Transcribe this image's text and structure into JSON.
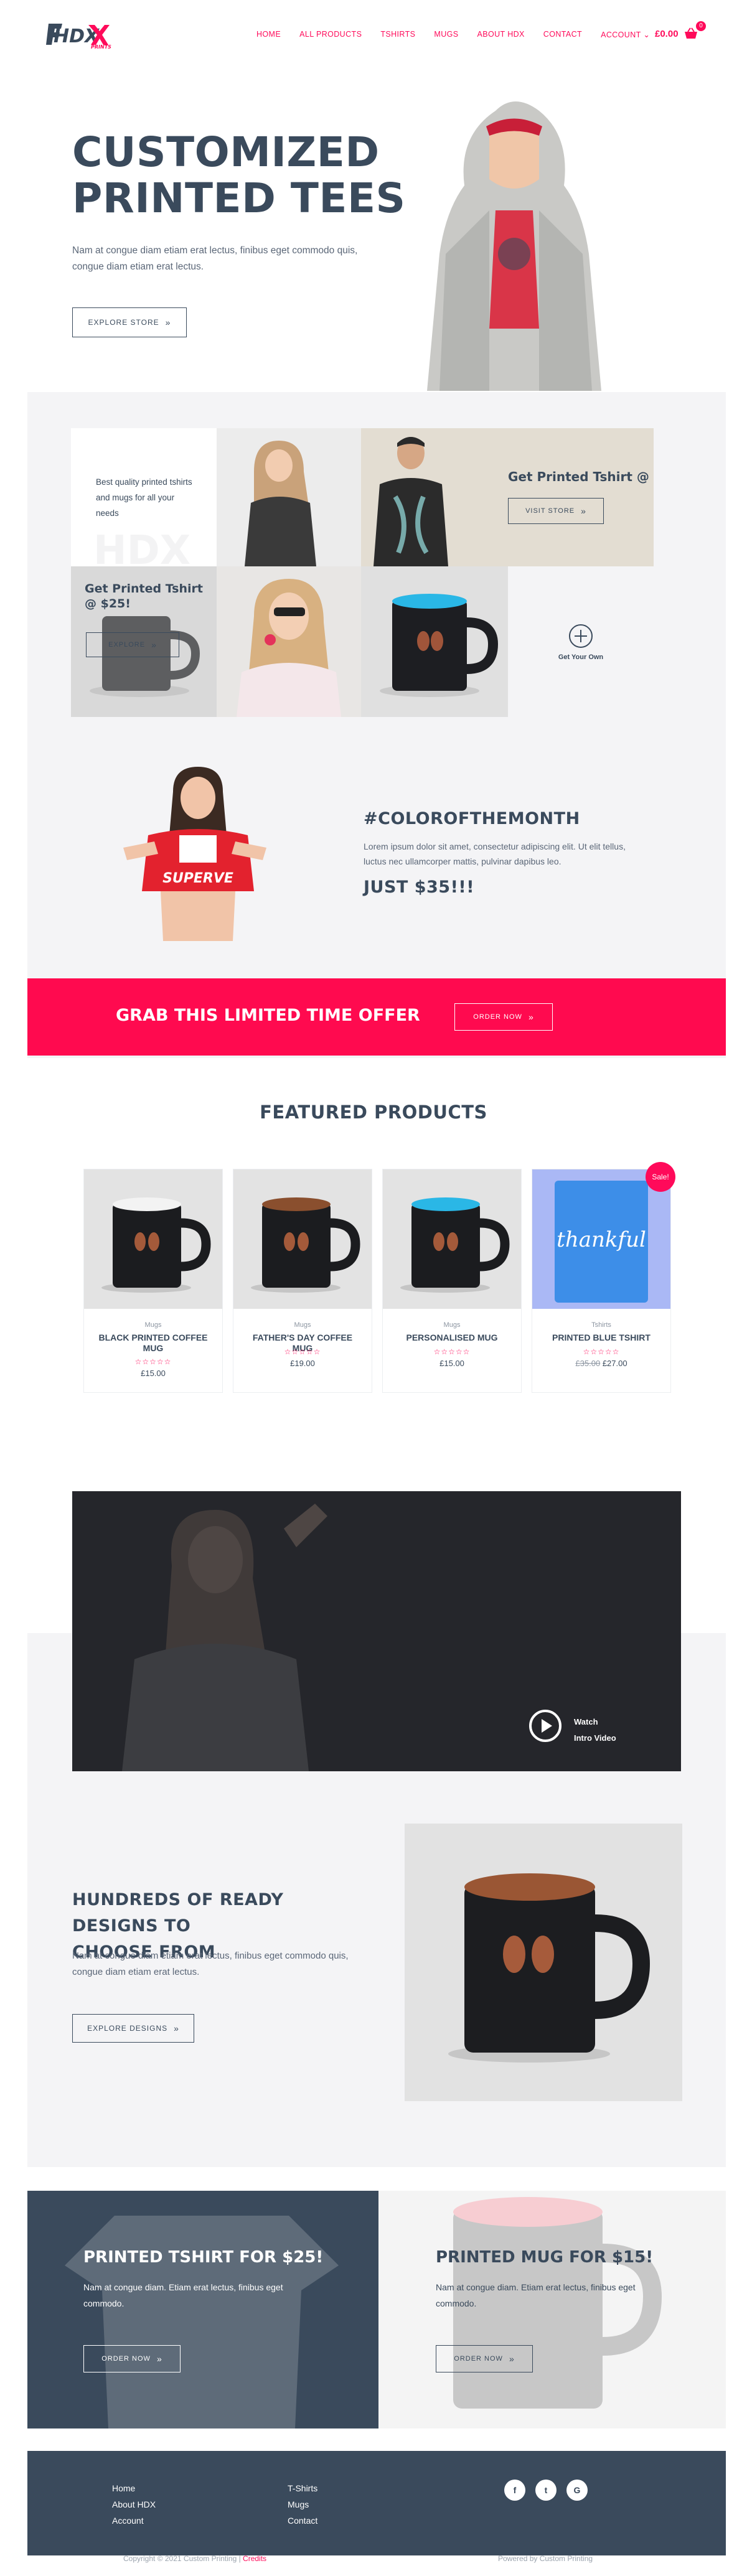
{
  "header": {
    "logo_text": "HDX",
    "logo_sub": "PRINTS",
    "nav": [
      "HOME",
      "ALL PRODUCTS",
      "TSHIRTS",
      "MUGS",
      "ABOUT HDX",
      "CONTACT",
      "ACCOUNT"
    ],
    "cart_total": "£0.00",
    "cart_count": "0"
  },
  "hero": {
    "title_line1": "CUSTOMIZED",
    "title_line2": "PRINTED TEES",
    "text": "Nam at congue diam etiam erat lectus, finibus eget commodo quis, congue diam etiam erat lectus.",
    "button": "EXPLORE STORE"
  },
  "grid": {
    "intro_text": "Best quality printed tshirts and mugs for all your needs",
    "tshirt_offer": "Get Printed Tshirt @ $25!",
    "visit_button": "VISIT STORE",
    "mug_offer": "Get Printed Tshirt @ $25!",
    "mug_button": "EXPLORE",
    "get_your_own": "Get Your Own"
  },
  "color_month": {
    "title": "#COLOROFTHEMONTH",
    "text": "Lorem ipsum dolor sit amet, consectetur adipiscing elit. Ut elit tellus, luctus nec ullamcorper mattis, pulvinar dapibus leo.",
    "price": "JUST $35!!!"
  },
  "promo": {
    "title": "GRAB THIS LIMITED TIME OFFER",
    "button": "ORDER NOW"
  },
  "featured": {
    "title": "FEATURED PRODUCTS",
    "sale_badge": "Sale!",
    "products": [
      {
        "category": "Mugs",
        "name": "BLACK PRINTED COFFEE MUG",
        "price": "£15.00",
        "old_price": ""
      },
      {
        "category": "Mugs",
        "name": "FATHER'S DAY COFFEE MUG",
        "price": "£19.00",
        "old_price": ""
      },
      {
        "category": "Mugs",
        "name": "PERSONALISED MUG",
        "price": "£15.00",
        "old_price": ""
      },
      {
        "category": "Tshirts",
        "name": "PRINTED BLUE TSHIRT",
        "price": "£27.00",
        "old_price": "£35.00"
      }
    ]
  },
  "video": {
    "label_line1": "Watch",
    "label_line2": "Intro Video"
  },
  "designs": {
    "title_line1": "HUNDREDS OF READY DESIGNS TO",
    "title_line2": "CHOOSE FROM",
    "text": "Nam at congue diam etiam erat lectus, finibus eget commodo quis, congue diam etiam erat lectus.",
    "button": "EXPLORE DESIGNS"
  },
  "offers": {
    "tshirt_title": "PRINTED TSHIRT FOR $25!",
    "tshirt_text": "Nam at congue diam. Etiam erat lectus, finibus eget commodo.",
    "tshirt_button": "ORDER NOW",
    "mug_title": "PRINTED MUG FOR $15!",
    "mug_text": "Nam at congue diam. Etiam erat lectus, finibus eget commodo.",
    "mug_button": "ORDER NOW"
  },
  "footer": {
    "col1": [
      "Home",
      "About HDX",
      "Account"
    ],
    "col2": [
      "T-Shirts",
      "Mugs",
      "Contact"
    ],
    "social": [
      "f",
      "t",
      "G"
    ],
    "copyright_prefix": "Copyright © 2021 Custom Printing | ",
    "credits": "Credits",
    "powered": "Powered by Custom Printing"
  },
  "colors": {
    "accent": "#ff0a5a",
    "navy": "#3a4a5c",
    "band": "#f4f4f6"
  }
}
